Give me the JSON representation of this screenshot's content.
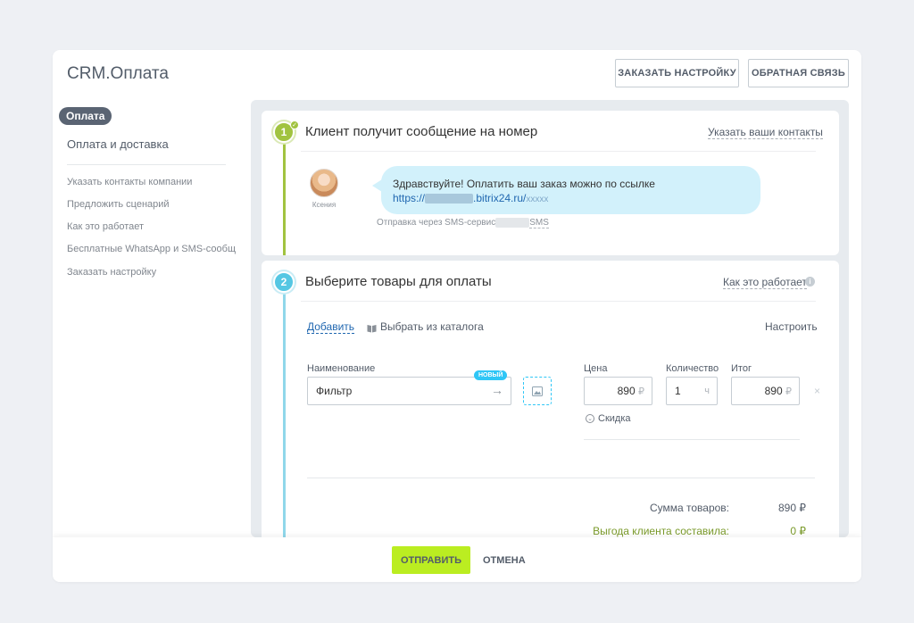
{
  "header": {
    "title": "CRM.Оплата",
    "order_setup_button": "ЗАКАЗАТЬ НАСТРОЙКУ",
    "feedback_button": "ОБРАТНАЯ СВЯЗЬ"
  },
  "sidebar": {
    "active_item": "Оплата",
    "main_item": "Оплата и доставка",
    "links": [
      "Указать контакты компании",
      "Предложить сценарий",
      "Как это работает",
      "Бесплатные WhatsApp и SMS-сообщ...",
      "Заказать настройку"
    ]
  },
  "step1": {
    "number": "1",
    "title": "Клиент получит сообщение на номер",
    "action_link": "Указать ваши контакты",
    "avatar_name": "Ксения",
    "message_text": "Здравствуйте! Оплатить ваш заказ можно по ссылке",
    "message_url_prefix": "https://",
    "message_url_domain": ".bitrix24.ru/",
    "message_url_suffix": "xxxxx",
    "sms_note_prefix": "Отправка через SMS-сервис",
    "sms_note_suffix": "SMS"
  },
  "step2": {
    "number": "2",
    "title": "Выберите товары для оплаты",
    "help_link": "Как это работает",
    "add_link": "Добавить",
    "catalog_link": "Выбрать из каталога",
    "configure_link": "Настроить",
    "columns": {
      "name": "Наименование",
      "price": "Цена",
      "quantity": "Количество",
      "total": "Итог"
    },
    "new_badge": "НОВЫЙ",
    "product": {
      "name": "Фильтр",
      "price": "890",
      "currency": "₽",
      "quantity": "1",
      "unit": "ч",
      "total": "890"
    },
    "discount_label": "Скидка",
    "summary": {
      "goods_total_label": "Сумма товаров:",
      "goods_total_value": "890 ₽",
      "benefit_label": "Выгода клиента составила:",
      "benefit_value": "0 ₽"
    }
  },
  "footer": {
    "send_button": "ОТПРАВИТЬ",
    "cancel_button": "ОТМЕНА"
  },
  "colors": {
    "accent_green": "#bbed21",
    "step1_green": "#a1c340",
    "step2_blue": "#55c7e3",
    "link_blue": "#2067b0",
    "bubble_bg": "#d2f1fb",
    "sidebar_active_bg": "#5a6473"
  }
}
